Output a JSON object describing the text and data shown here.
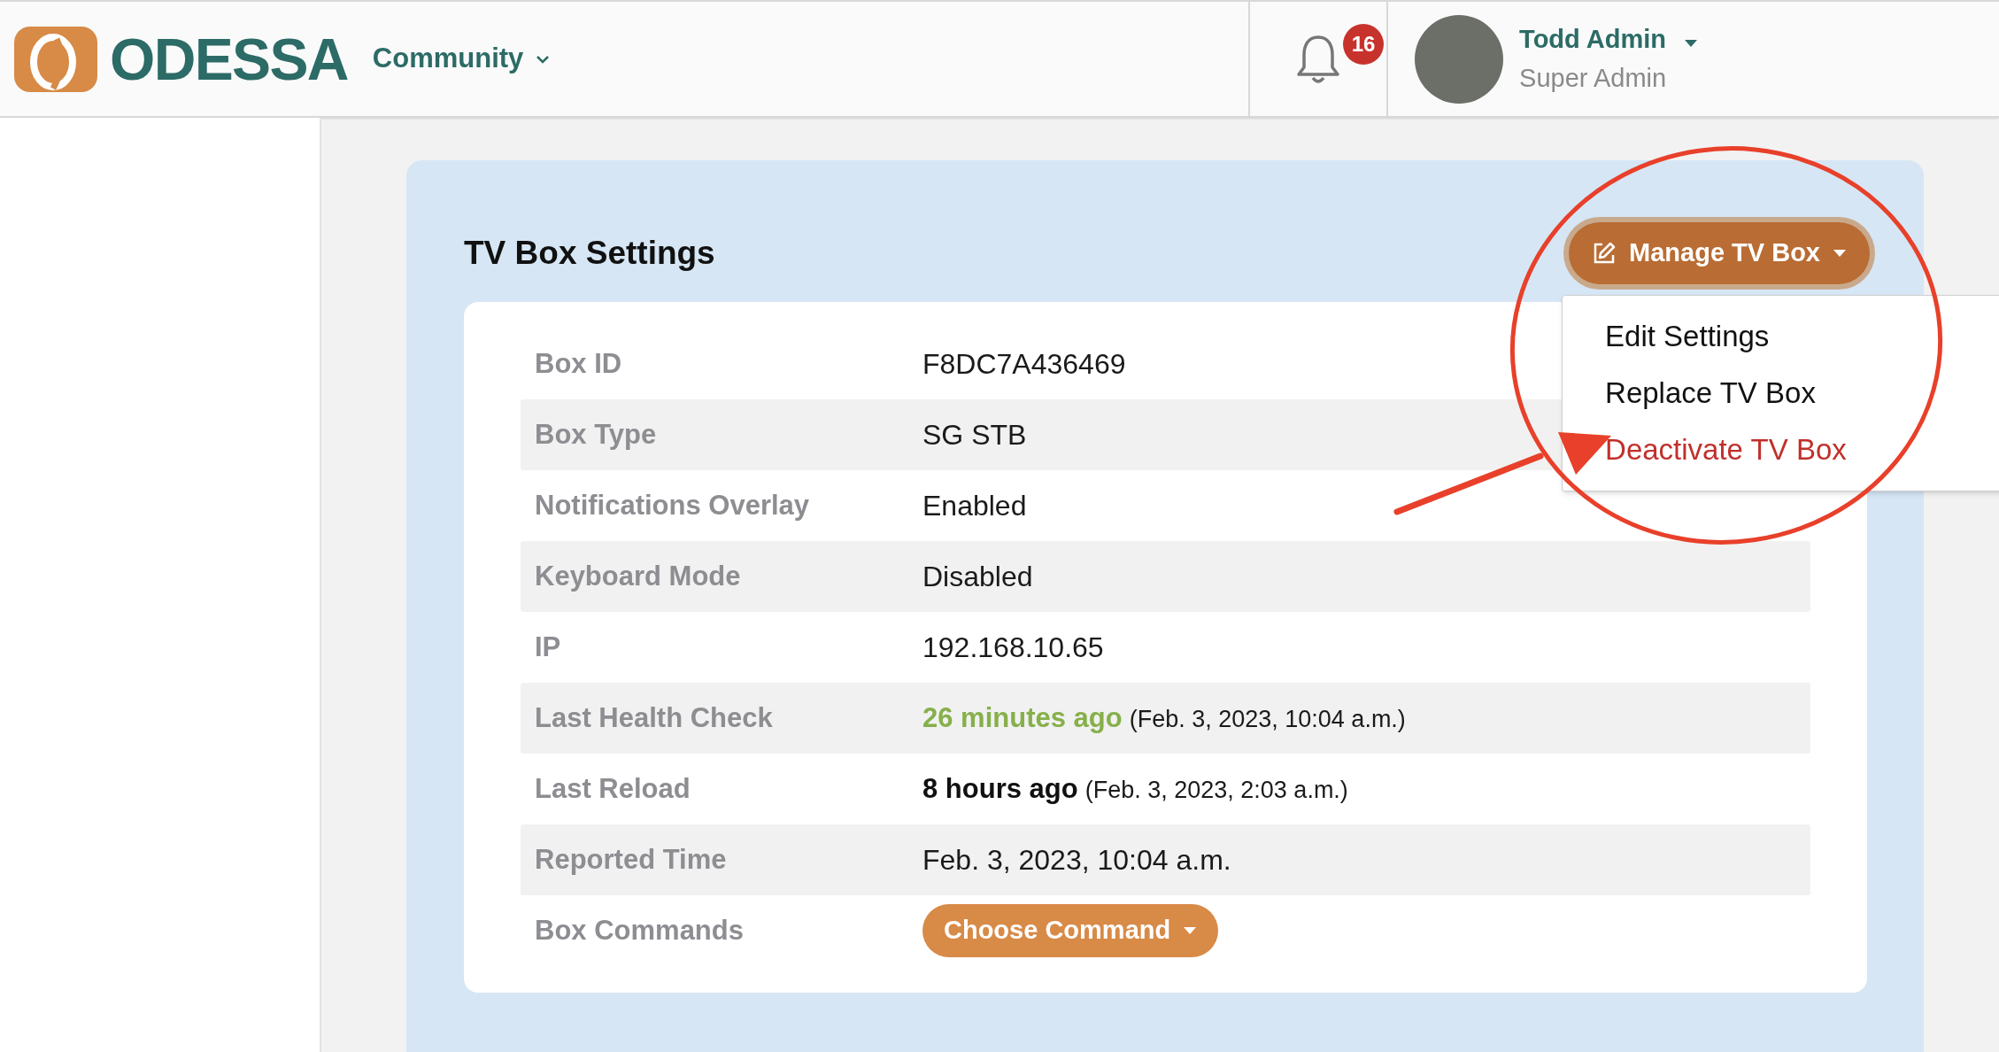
{
  "header": {
    "logo_text": "ODESSA",
    "community_menu": "Community",
    "notifications": {
      "count": "16"
    },
    "user": {
      "name": "Todd Admin",
      "role": "Super Admin"
    }
  },
  "panel": {
    "title": "TV Box Settings",
    "manage_button": "Manage TV Box",
    "manage_menu": {
      "expanded": true,
      "items": [
        {
          "label": "Edit Settings",
          "danger": false
        },
        {
          "label": "Replace TV Box",
          "danger": false
        },
        {
          "label": "Deactivate TV Box",
          "danger": true
        }
      ]
    },
    "rows": [
      {
        "label": "Box ID",
        "kind": "text",
        "value": "F8DC7A436469"
      },
      {
        "label": "Box Type",
        "kind": "text",
        "value": "SG STB"
      },
      {
        "label": "Notifications Overlay",
        "kind": "text",
        "value": "Enabled"
      },
      {
        "label": "Keyboard Mode",
        "kind": "text",
        "value": "Disabled"
      },
      {
        "label": "IP",
        "kind": "text",
        "value": "192.168.10.65"
      },
      {
        "label": "Last Health Check",
        "kind": "relative_time",
        "emphasis": "26 minutes ago",
        "color": "#86b04a",
        "detail": "(Feb. 3, 2023, 10:04 a.m.)"
      },
      {
        "label": "Last Reload",
        "kind": "relative_time",
        "emphasis": "8 hours ago",
        "color": "#111111",
        "detail": "(Feb. 3, 2023, 2:03 a.m.)"
      },
      {
        "label": "Reported Time",
        "kind": "text",
        "value": "Feb. 3, 2023, 10:04 a.m."
      },
      {
        "label": "Box Commands",
        "kind": "button",
        "value": "Choose Command"
      }
    ]
  },
  "annotation": {
    "circled": true
  }
}
